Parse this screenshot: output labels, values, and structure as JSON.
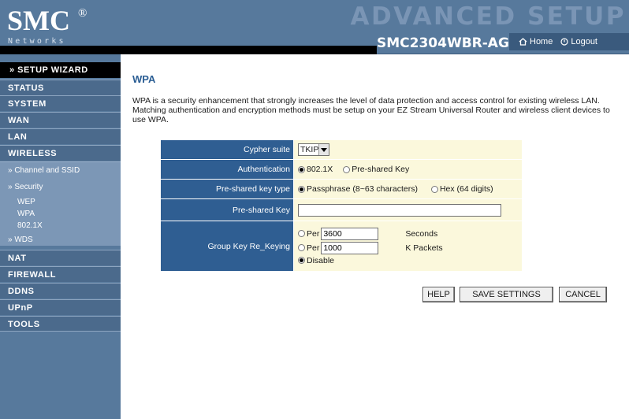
{
  "header": {
    "logo_text": "SMC",
    "logo_reg": "®",
    "logo_sub": "Networks",
    "banner": "ADVANCED SETUP",
    "model": "SMC2304WBR-AG",
    "home": "Home",
    "logout": "Logout"
  },
  "sidebar": {
    "wizard": "» SETUP WIZARD",
    "items": [
      "STATUS",
      "SYSTEM",
      "WAN",
      "LAN",
      "WIRELESS"
    ],
    "wireless_sub": {
      "channel": "» Channel and SSID",
      "security": "» Security",
      "wep": "WEP",
      "wpa": "WPA",
      "x8021": "802.1X",
      "wds": "» WDS"
    },
    "items2": [
      "NAT",
      "FIREWALL",
      "DDNS",
      "UPnP",
      "TOOLS"
    ]
  },
  "main": {
    "title": "WPA",
    "description": "WPA is a security enhancement that strongly increases the level of data protection and access control for existing wireless LAN. Matching authentication and encryption methods must be setup on your EZ Stream Universal Router and wireless client devices to use WPA.",
    "form": {
      "cypher_label": "Cypher suite",
      "cypher_value": "TKIP",
      "auth_label": "Authentication",
      "auth_opt1": "802.1X",
      "auth_opt2": "Pre-shared Key",
      "psk_type_label": "Pre-shared key type",
      "psk_type_opt1": "Passphrase (8~63 characters)",
      "psk_type_opt2": "Hex (64 digits)",
      "psk_label": "Pre-shared Key",
      "psk_value": "",
      "rekey_label": "Group Key Re_Keying",
      "per": "Per",
      "seconds_value": "3600",
      "seconds_unit": "Seconds",
      "packets_value": "1000",
      "packets_unit": "K Packets",
      "disable": "Disable"
    },
    "buttons": {
      "help": "HELP",
      "save": "SAVE SETTINGS",
      "cancel": "CANCEL"
    }
  }
}
